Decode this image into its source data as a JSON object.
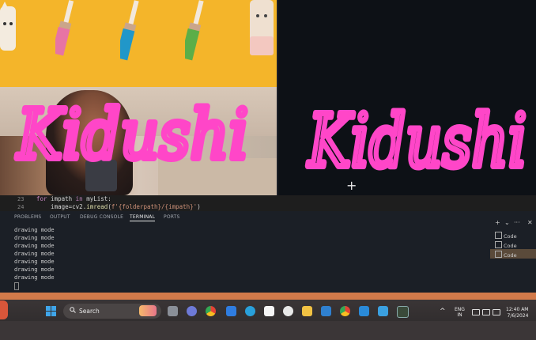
{
  "drawing": {
    "text": "Kidushi",
    "color": "#ff46c8"
  },
  "editor": {
    "lines": [
      {
        "number": "23",
        "keyword_for": "for",
        "rest1": " impath ",
        "keyword_in": "in",
        "rest2": " myList:"
      },
      {
        "number": "24",
        "prefix": "    image=cv2.",
        "func": "imread",
        "paren": "(",
        "fstring": "f'{folderpath}/{impath}'",
        "close": ")"
      }
    ]
  },
  "panel": {
    "tabs": [
      "PROBLEMS",
      "OUTPUT",
      "DEBUG CONSOLE",
      "TERMINAL",
      "PORTS"
    ],
    "active_tab": "TERMINAL",
    "terminal_lines": [
      "drawing mode",
      "drawing mode",
      "drawing mode",
      "drawing mode",
      "drawing mode",
      "drawing mode",
      "drawing mode"
    ],
    "terminal_list": [
      "Code",
      "Code",
      "Code"
    ],
    "controls": {
      "add": "+",
      "chevron": "⌄",
      "more": "···",
      "close": "✕"
    }
  },
  "taskbar": {
    "search_placeholder": "Search",
    "language": "ENG",
    "region": "IN",
    "time": "12:40 AM",
    "date": "7/6/2024",
    "chevron": "^"
  },
  "colors": {
    "toolbar_bg": "#f4b52a",
    "canvas_bg": "#0d1116",
    "brush": "#ff46c8",
    "accent": "#3fa5ea"
  }
}
